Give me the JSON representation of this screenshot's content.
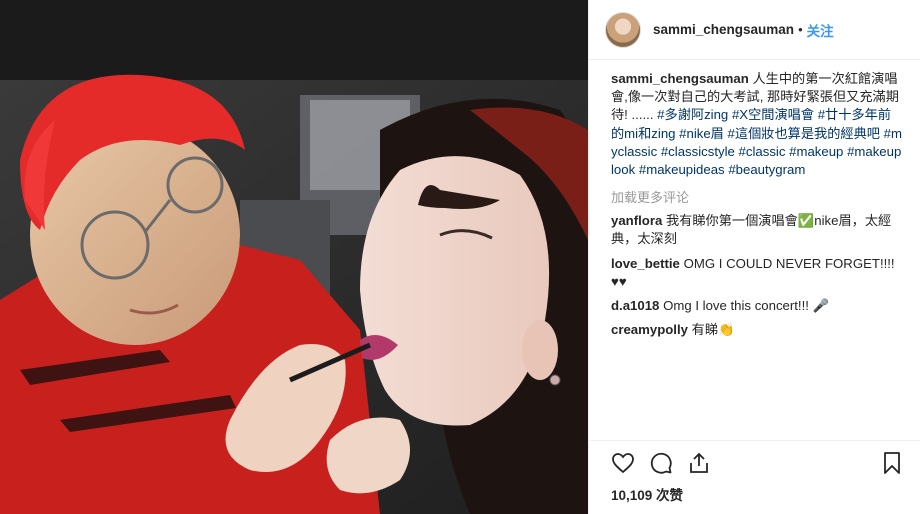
{
  "post": {
    "username": "sammi_chengsauman",
    "follow_label": "关注",
    "dot": "•"
  },
  "caption": {
    "username": "sammi_chengsauman",
    "text": "人生中的第一次紅館演唱會,像一次對自己的大考試, 那時好緊張但又充滿期待! ......",
    "tags": [
      "#多謝阿zing",
      "#X空間演唱會",
      "#廿十多年前的mi和zing",
      "#nike眉",
      "#這個妝也算是我的經典吧",
      "#myclassic",
      "#classicstyle",
      "#classic",
      "#makeup",
      "#makeuplook",
      "#makeupideas",
      "#beautygram"
    ]
  },
  "load_more": "加载更多评论",
  "comments": [
    {
      "user": "yanflora",
      "text": "我有睇你第一個演唱會✅nike眉，太經典，太深刻"
    },
    {
      "user": "love_bettie",
      "text": "OMG I COULD NEVER FORGET!!!! ♥♥"
    },
    {
      "user": "d.a1018",
      "text": "Omg I love this concert!!! 🎤"
    },
    {
      "user": "creamypolly",
      "text": "有睇👏"
    }
  ],
  "likes": "10,109 次赞",
  "icons": {
    "like": "heart-icon",
    "comment": "comment-icon",
    "share": "share-icon",
    "save": "bookmark-icon"
  },
  "colors": {
    "accent": "#3897f0",
    "hashtag": "#003569",
    "muted": "#999999"
  }
}
